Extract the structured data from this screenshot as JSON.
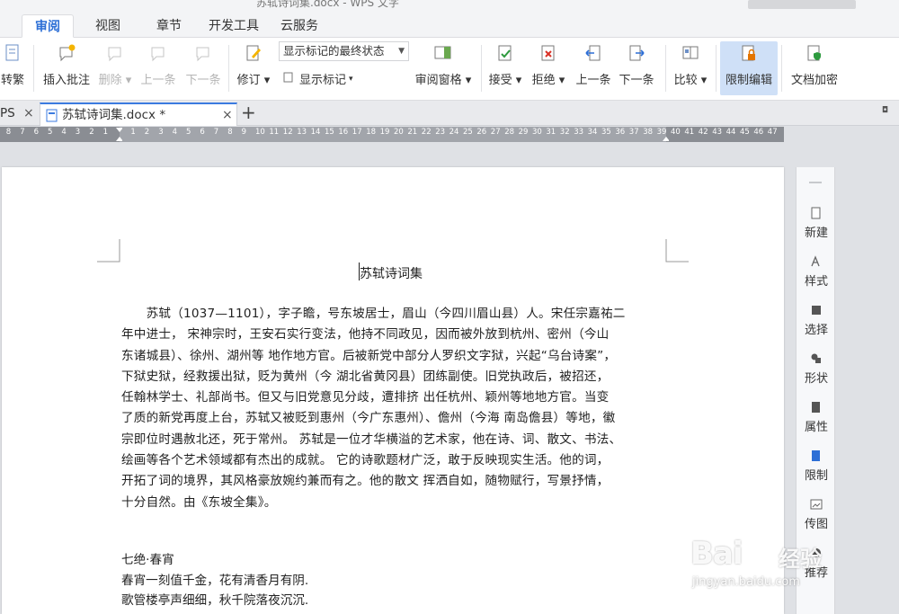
{
  "window": {
    "title_fragment": "苏轼诗词集.docx - WPS 文字"
  },
  "menu_tabs": [
    {
      "label": "审阅",
      "active": true
    },
    {
      "label": "视图"
    },
    {
      "label": "章节"
    },
    {
      "label": "开发工具"
    },
    {
      "label": "云服务"
    }
  ],
  "ribbon": {
    "convert": "转繁",
    "insert_comment": "插入批注",
    "delete": "删除",
    "prev_comment": "上一条",
    "next_comment": "下一条",
    "revise": "修订",
    "markup_state": "显示标记的最终状态",
    "show_markup": "显示标记",
    "review_pane": "审阅窗格",
    "accept": "接受",
    "reject": "拒绝",
    "prev_change": "上一条",
    "next_change": "下一条",
    "compare": "比较",
    "restrict_edit": "限制编辑",
    "encrypt": "文档加密"
  },
  "doc_tabs": {
    "partial": "PS",
    "active": "苏轼诗词集.docx *",
    "add": "+"
  },
  "ruler": {
    "left_numbers": [
      "8",
      "7",
      "6",
      "5",
      "4",
      "3",
      "2",
      "1"
    ],
    "right_numbers": [
      "1",
      "2",
      "3",
      "4",
      "5",
      "6",
      "7",
      "8",
      "9",
      "10",
      "11",
      "12",
      "13",
      "14",
      "15",
      "16",
      "17",
      "18",
      "19",
      "20",
      "21",
      "22",
      "23",
      "24",
      "25",
      "26",
      "27",
      "28",
      "29",
      "30",
      "31",
      "32",
      "33",
      "34",
      "35",
      "36",
      "37",
      "38",
      "39",
      "40",
      "41",
      "42",
      "43",
      "44",
      "45",
      "46",
      "47"
    ]
  },
  "document": {
    "title": "苏轼诗词集",
    "paragraph_lines": [
      "　　苏轼（1037—1101），字子瞻，号东坡居士，眉山（今四川眉山县）人。宋任宗嘉祐二",
      "年中进士，  宋神宗时，王安石实行变法，他持不同政见，因而被外放到杭州、密州（今山",
      "东诸城县）、徐州、湖州等  地作地方官。后被新党中部分人罗织文字狱，兴起“乌台诗案”，",
      "下狱史狱，经救援出狱，贬为黄州（今  湖北省黄冈县）团练副使。旧党执政后，被招还，",
      "任翰林学士、礼部尚书。但又与旧党意见分歧，遭排挤  出任杭州、颖州等地地方官。当变",
      "了质的新党再度上台，苏轼又被贬到惠州（今广东惠州）、儋州（今海  南岛儋县）等地，徽",
      "宗即位时遇赦北还，死于常州。  苏轼是一位才华横溢的艺术家，他在诗、词、散文、书法、",
      "绘画等各个艺术领域都有杰出的成就。  它的诗歌题材广泛，敢于反映现实生活。他的词，",
      "开拓了词的境界，其风格豪放婉约兼而有之。他的散文  挥洒自如，随物赋行，写景抒情，",
      "十分自然。由《东坡全集》。"
    ],
    "poem_title": "七绝·春宵",
    "poem_lines": [
      "春宵一刻值千金，花有清香月有阴.",
      "歌管楼亭声细细，秋千院落夜沉沉."
    ]
  },
  "task_pane": [
    {
      "label": "新建",
      "icon": "new-doc-icon"
    },
    {
      "label": "样式",
      "icon": "style-icon"
    },
    {
      "label": "选择",
      "icon": "select-icon"
    },
    {
      "label": "形状",
      "icon": "shape-icon"
    },
    {
      "label": "属性",
      "icon": "property-icon"
    },
    {
      "label": "限制",
      "icon": "restrict-icon"
    },
    {
      "label": "传图",
      "icon": "upload-image-icon"
    },
    {
      "label": "推荐",
      "icon": "recommend-icon"
    }
  ],
  "watermark": {
    "brand": "Bai",
    "brand_cn": "经验",
    "url": "jingyan.baidu.com"
  },
  "colors": {
    "accent": "#2d6fd6",
    "active_button": "#cfe0f7",
    "ruler": "#8a8d93"
  }
}
